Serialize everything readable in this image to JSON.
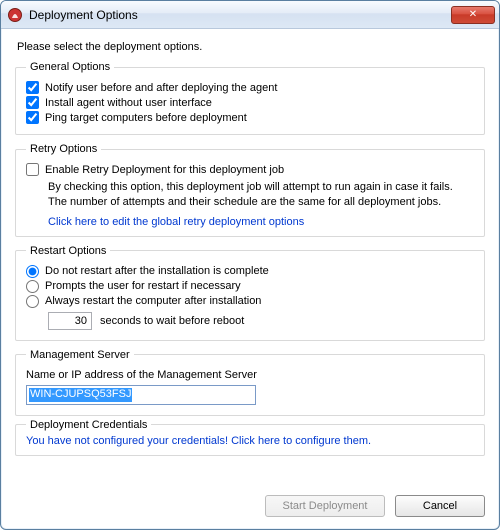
{
  "window": {
    "title": "Deployment Options",
    "close_glyph": "✕"
  },
  "instruction": "Please select the deployment options.",
  "general": {
    "legend": "General Options",
    "notify": {
      "label": "Notify user before and after deploying the agent",
      "checked": true
    },
    "noui": {
      "label": "Install agent without user interface",
      "checked": true
    },
    "ping": {
      "label": "Ping target computers before deployment",
      "checked": true
    }
  },
  "retry": {
    "legend": "Retry Options",
    "enable": {
      "label": "Enable Retry Deployment for this deployment job",
      "checked": false
    },
    "desc": "By checking this option, this deployment job will attempt to run again in case it fails. The number of attempts and their schedule are the same for all deployment jobs.",
    "link": "Click here to edit the global retry deployment options"
  },
  "restart": {
    "legend": "Restart Options",
    "selected": "no_restart",
    "no_restart": {
      "label": "Do not restart after the installation is complete"
    },
    "prompt": {
      "label": "Prompts the user for restart if necessary"
    },
    "always": {
      "label": "Always restart the computer after installation"
    },
    "seconds_value": "30",
    "seconds_label": "seconds to wait before reboot"
  },
  "mgmt": {
    "legend": "Management Server",
    "label": "Name or IP address of the Management Server",
    "value": "WIN-CJUPSQ53FSJ"
  },
  "creds": {
    "legend": "Deployment Credentials",
    "warn": "You have not configured your credentials! Click here to configure them."
  },
  "buttons": {
    "start": "Start Deployment",
    "cancel": "Cancel"
  },
  "colors": {
    "link": "#0038d0",
    "accent": "#3399ff"
  }
}
